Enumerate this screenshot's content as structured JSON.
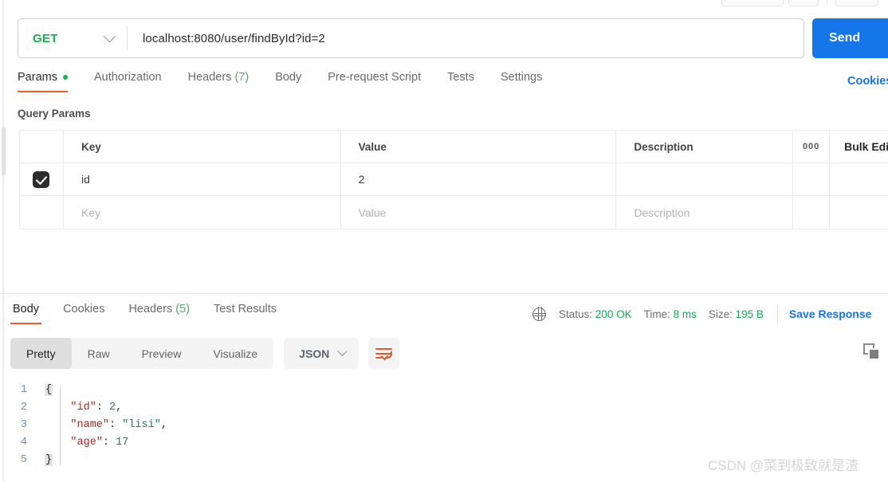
{
  "request": {
    "method": "GET",
    "url": "localhost:8080/user/findById?id=2",
    "send_label": "Send",
    "tabs": [
      {
        "label": "Params",
        "active": true,
        "dot": true
      },
      {
        "label": "Authorization",
        "active": false
      },
      {
        "label": "Headers",
        "count": "(7)",
        "active": false
      },
      {
        "label": "Body",
        "active": false
      },
      {
        "label": "Pre-request Script",
        "active": false
      },
      {
        "label": "Tests",
        "active": false
      },
      {
        "label": "Settings",
        "active": false
      }
    ],
    "cookies_link": "Cookies"
  },
  "query_params": {
    "section_title": "Query Params",
    "columns": [
      "Key",
      "Value",
      "Description"
    ],
    "dots_label": "000",
    "bulk_edit_label": "Bulk Edit",
    "rows": [
      {
        "checked": true,
        "key": "id",
        "value": "2",
        "description": ""
      }
    ],
    "placeholder_row": {
      "key": "Key",
      "value": "Value",
      "description": "Description"
    }
  },
  "response": {
    "tabs": [
      {
        "label": "Body",
        "active": true
      },
      {
        "label": "Cookies",
        "active": false
      },
      {
        "label": "Headers",
        "count": "(5)",
        "active": false
      },
      {
        "label": "Test Results",
        "active": false
      }
    ],
    "meta": {
      "status_label": "Status:",
      "status_value": "200 OK",
      "time_label": "Time:",
      "time_value": "8 ms",
      "size_label": "Size:",
      "size_value": "195 B"
    },
    "save_response": "Save Response",
    "view_modes": [
      {
        "label": "Pretty",
        "active": true
      },
      {
        "label": "Raw",
        "active": false
      },
      {
        "label": "Preview",
        "active": false
      },
      {
        "label": "Visualize",
        "active": false
      }
    ],
    "format": "JSON",
    "body_lines": [
      {
        "num": "1",
        "segments": [
          {
            "t": "{",
            "c": "brace"
          }
        ]
      },
      {
        "num": "2",
        "segments": [
          {
            "t": "    ",
            "c": "p"
          },
          {
            "t": "\"id\"",
            "c": "k"
          },
          {
            "t": ": ",
            "c": "p"
          },
          {
            "t": "2",
            "c": "n"
          },
          {
            "t": ",",
            "c": "p"
          }
        ]
      },
      {
        "num": "3",
        "segments": [
          {
            "t": "    ",
            "c": "p"
          },
          {
            "t": "\"name\"",
            "c": "k"
          },
          {
            "t": ": ",
            "c": "p"
          },
          {
            "t": "\"lisi\"",
            "c": "s"
          },
          {
            "t": ",",
            "c": "p"
          }
        ]
      },
      {
        "num": "4",
        "segments": [
          {
            "t": "    ",
            "c": "p"
          },
          {
            "t": "\"age\"",
            "c": "k"
          },
          {
            "t": ": ",
            "c": "p"
          },
          {
            "t": "17",
            "c": "n"
          }
        ]
      },
      {
        "num": "5",
        "segments": [
          {
            "t": "}",
            "c": "brace"
          }
        ]
      }
    ]
  },
  "watermark": "CSDN @菜到极致就是渣",
  "colors": {
    "accent_orange": "#ef5b25",
    "send_blue": "#1476e8",
    "link_blue": "#1773e8",
    "method_green": "#14b14a",
    "status_green": "#18a957"
  }
}
